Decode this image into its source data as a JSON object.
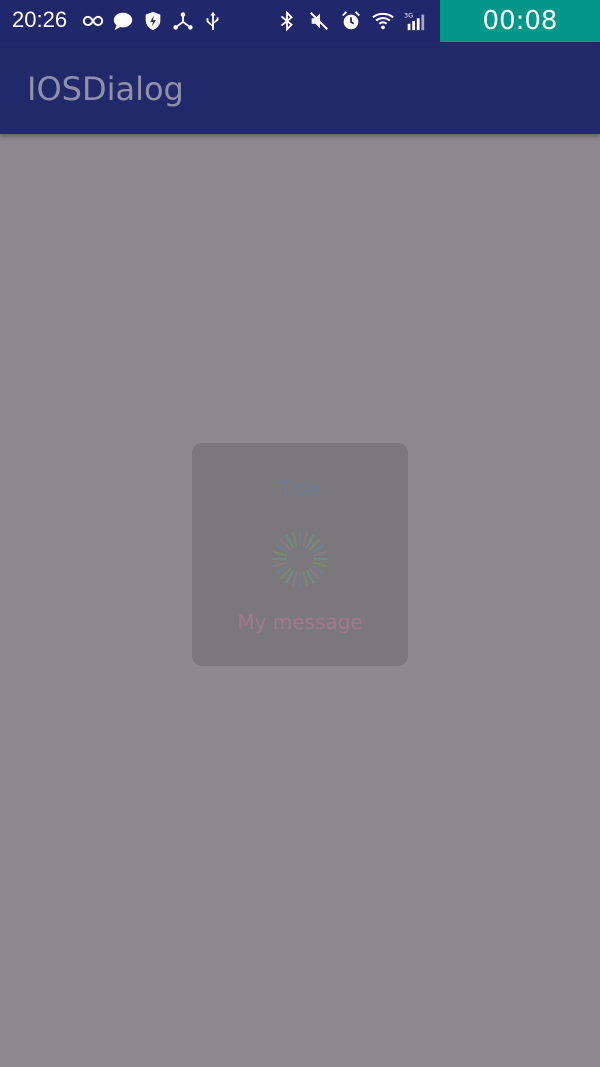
{
  "status_bar": {
    "time": "20:26",
    "icons_left": [
      "infinity-icon",
      "chat-bubble-icon",
      "shield-icon",
      "network-share-icon",
      "usb-icon"
    ],
    "icons_right": [
      "bluetooth-icon",
      "mute-icon",
      "alarm-icon",
      "wifi-icon",
      "signal-3g-icon"
    ],
    "network_label": "3G",
    "recording_timer": "00:08"
  },
  "app_bar": {
    "title": "IOSDialog"
  },
  "dialog": {
    "title": "Title",
    "message": "My message",
    "spinner_icon": "loading-spinner-icon"
  },
  "colors": {
    "status_bar_bg": "#21276b",
    "app_bar_bg": "#22296b",
    "scrim_bg": "#8c8a8c",
    "timer_bg": "#00978b",
    "dialog_bg": "#7a787a",
    "dialog_title": "#6f7a95",
    "dialog_message": "#a7778a"
  }
}
